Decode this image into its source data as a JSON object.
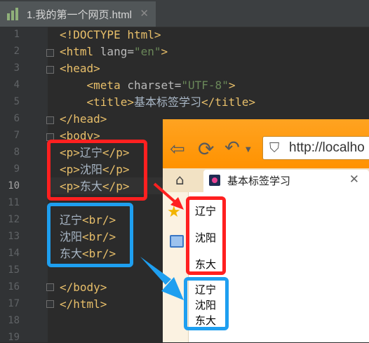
{
  "editor": {
    "tab_title": "1.我的第一个网页.html",
    "tab_close": "✕",
    "lines": [
      {
        "n": "1",
        "parts": [
          {
            "c": "tg",
            "t": "<!DOCTYPE html>"
          }
        ]
      },
      {
        "n": "2",
        "parts": [
          {
            "c": "tg",
            "t": "<html "
          },
          {
            "c": "at",
            "t": "lang="
          },
          {
            "c": "st",
            "t": "\"en\""
          },
          {
            "c": "tg",
            "t": ">"
          }
        ]
      },
      {
        "n": "3",
        "parts": [
          {
            "c": "tg",
            "t": "<head>"
          }
        ]
      },
      {
        "n": "4",
        "parts": [
          {
            "c": "tx",
            "t": "    "
          },
          {
            "c": "tg",
            "t": "<meta "
          },
          {
            "c": "at",
            "t": "charset="
          },
          {
            "c": "st",
            "t": "\"UTF-8\""
          },
          {
            "c": "tg",
            "t": ">"
          }
        ]
      },
      {
        "n": "5",
        "parts": [
          {
            "c": "tx",
            "t": "    "
          },
          {
            "c": "tg",
            "t": "<title>"
          },
          {
            "c": "bl",
            "t": "基本标签学习"
          },
          {
            "c": "tg",
            "t": "</title>"
          }
        ]
      },
      {
        "n": "6",
        "parts": [
          {
            "c": "tg",
            "t": "</head>"
          }
        ]
      },
      {
        "n": "7",
        "parts": [
          {
            "c": "tg",
            "t": "<body>"
          }
        ]
      },
      {
        "n": "8",
        "parts": [
          {
            "c": "tg",
            "t": "<p>"
          },
          {
            "c": "bl",
            "t": "辽宁"
          },
          {
            "c": "tg",
            "t": "</p>"
          }
        ]
      },
      {
        "n": "9",
        "parts": [
          {
            "c": "tg",
            "t": "<p>"
          },
          {
            "c": "bl",
            "t": "沈阳"
          },
          {
            "c": "tg",
            "t": "</p>"
          }
        ]
      },
      {
        "n": "10",
        "parts": [
          {
            "c": "tg",
            "t": "<p>"
          },
          {
            "c": "bl",
            "t": "东大"
          },
          {
            "c": "tg",
            "t": "</p>"
          }
        ]
      },
      {
        "n": "11",
        "parts": []
      },
      {
        "n": "12",
        "parts": [
          {
            "c": "bl",
            "t": "辽宁"
          },
          {
            "c": "tg",
            "t": "<br/>"
          }
        ]
      },
      {
        "n": "13",
        "parts": [
          {
            "c": "bl",
            "t": "沈阳"
          },
          {
            "c": "tg",
            "t": "<br/>"
          }
        ]
      },
      {
        "n": "14",
        "parts": [
          {
            "c": "bl",
            "t": "东大"
          },
          {
            "c": "tg",
            "t": "<br/>"
          }
        ]
      },
      {
        "n": "15",
        "parts": []
      },
      {
        "n": "16",
        "parts": [
          {
            "c": "tg",
            "t": "</body>"
          }
        ]
      },
      {
        "n": "17",
        "parts": [
          {
            "c": "tg",
            "t": "</html>"
          }
        ]
      },
      {
        "n": "18",
        "parts": []
      },
      {
        "n": "19",
        "parts": []
      }
    ],
    "current_line": "10"
  },
  "browser": {
    "url": "http://localho",
    "tab_title": "基本标签学习",
    "tab_close": "✕",
    "p_items": [
      "辽宁",
      "沈阳",
      "东大"
    ],
    "br_items": [
      "辽宁",
      "沈阳",
      "东大"
    ]
  },
  "colors": {
    "annotation_red": "#ff2020",
    "annotation_blue": "#1e9ff0",
    "browser_orange": "#ff9500"
  }
}
